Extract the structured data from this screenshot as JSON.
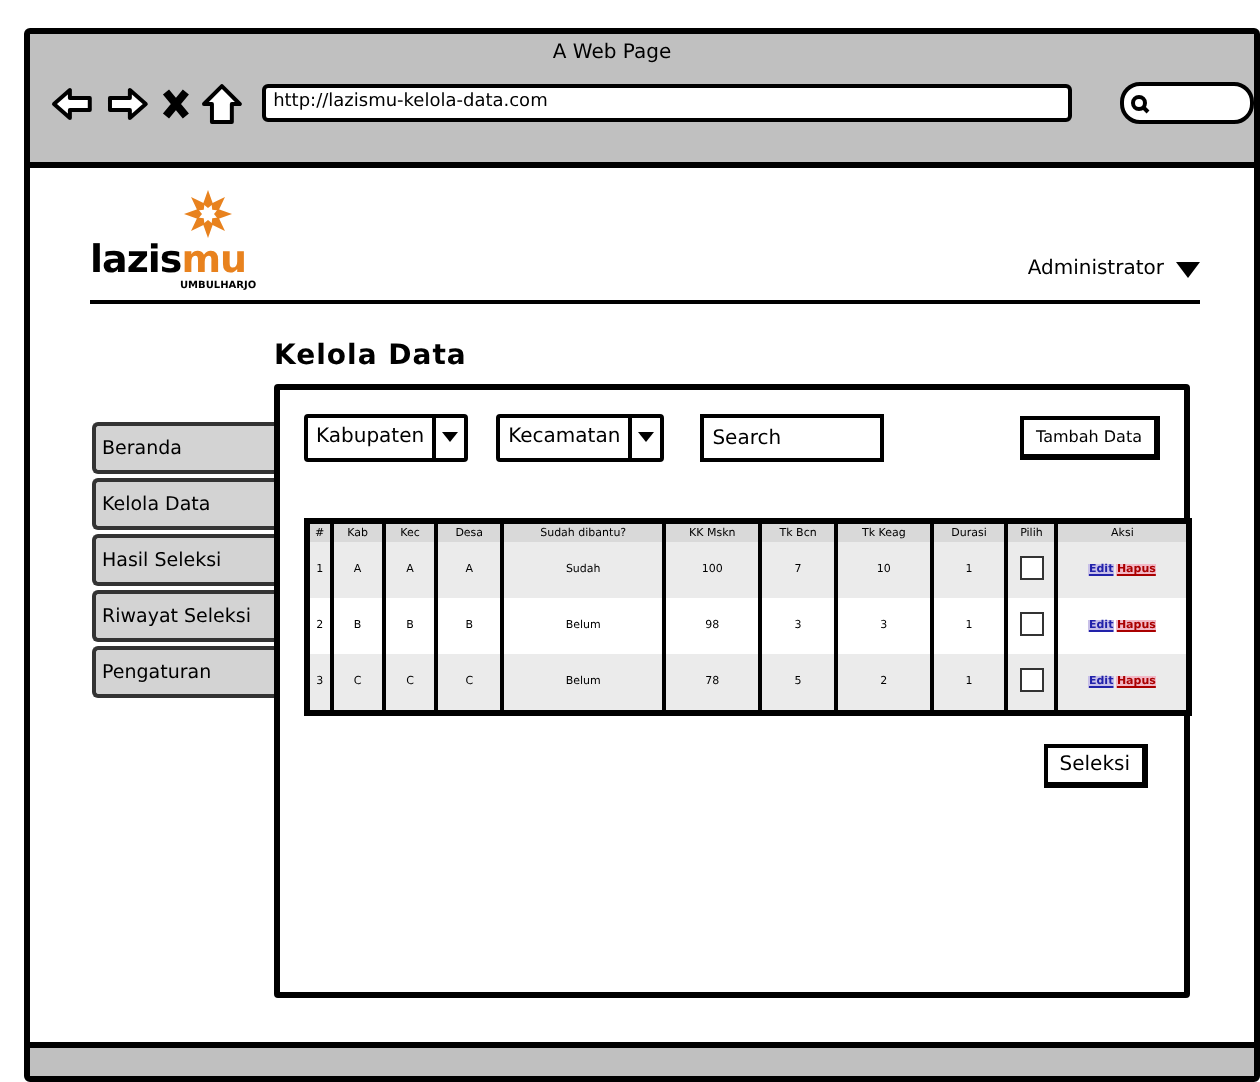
{
  "window": {
    "title": "A Web Page",
    "url": "http://lazismu-kelola-data.com"
  },
  "header": {
    "logo_part_1": "lazis",
    "logo_part_2": "mu",
    "logo_caption": "UMBULHARJO",
    "user": "Administrator"
  },
  "heading": "Kelola Data",
  "sidebar": {
    "items": [
      {
        "label": "Beranda"
      },
      {
        "label": "Kelola Data"
      },
      {
        "label": "Hasil Seleksi"
      },
      {
        "label": "Riwayat Seleksi"
      },
      {
        "label": "Pengaturan"
      }
    ]
  },
  "filters": {
    "dropdowns": [
      {
        "value": "Kabupaten"
      },
      {
        "value": "Kecamatan"
      }
    ],
    "search": {
      "placeholder": "Search"
    },
    "add_button": "Tambah Data"
  },
  "table": {
    "columns": [
      "#",
      "Kab",
      "Kec",
      "Desa",
      "Sudah dibantu?",
      "KK Mskn",
      "Tk Bcn",
      "Tk Keag",
      "Durasi",
      "Pilih",
      "Aksi"
    ],
    "rows": [
      {
        "cells": [
          "1",
          "A",
          "A",
          "A",
          "Sudah",
          "100",
          "7",
          "10",
          "1"
        ],
        "checked": false,
        "actions": [
          "Edit",
          "Hapus"
        ]
      },
      {
        "cells": [
          "2",
          "B",
          "B",
          "B",
          "Belum",
          "98",
          "3",
          "3",
          "1"
        ],
        "checked": false,
        "actions": [
          "Edit",
          "Hapus"
        ]
      },
      {
        "cells": [
          "3",
          "C",
          "C",
          "C",
          "Belum",
          "78",
          "5",
          "2",
          "1"
        ],
        "checked": false,
        "actions": [
          "Edit",
          "Hapus"
        ]
      }
    ]
  },
  "select_button": "Seleksi"
}
